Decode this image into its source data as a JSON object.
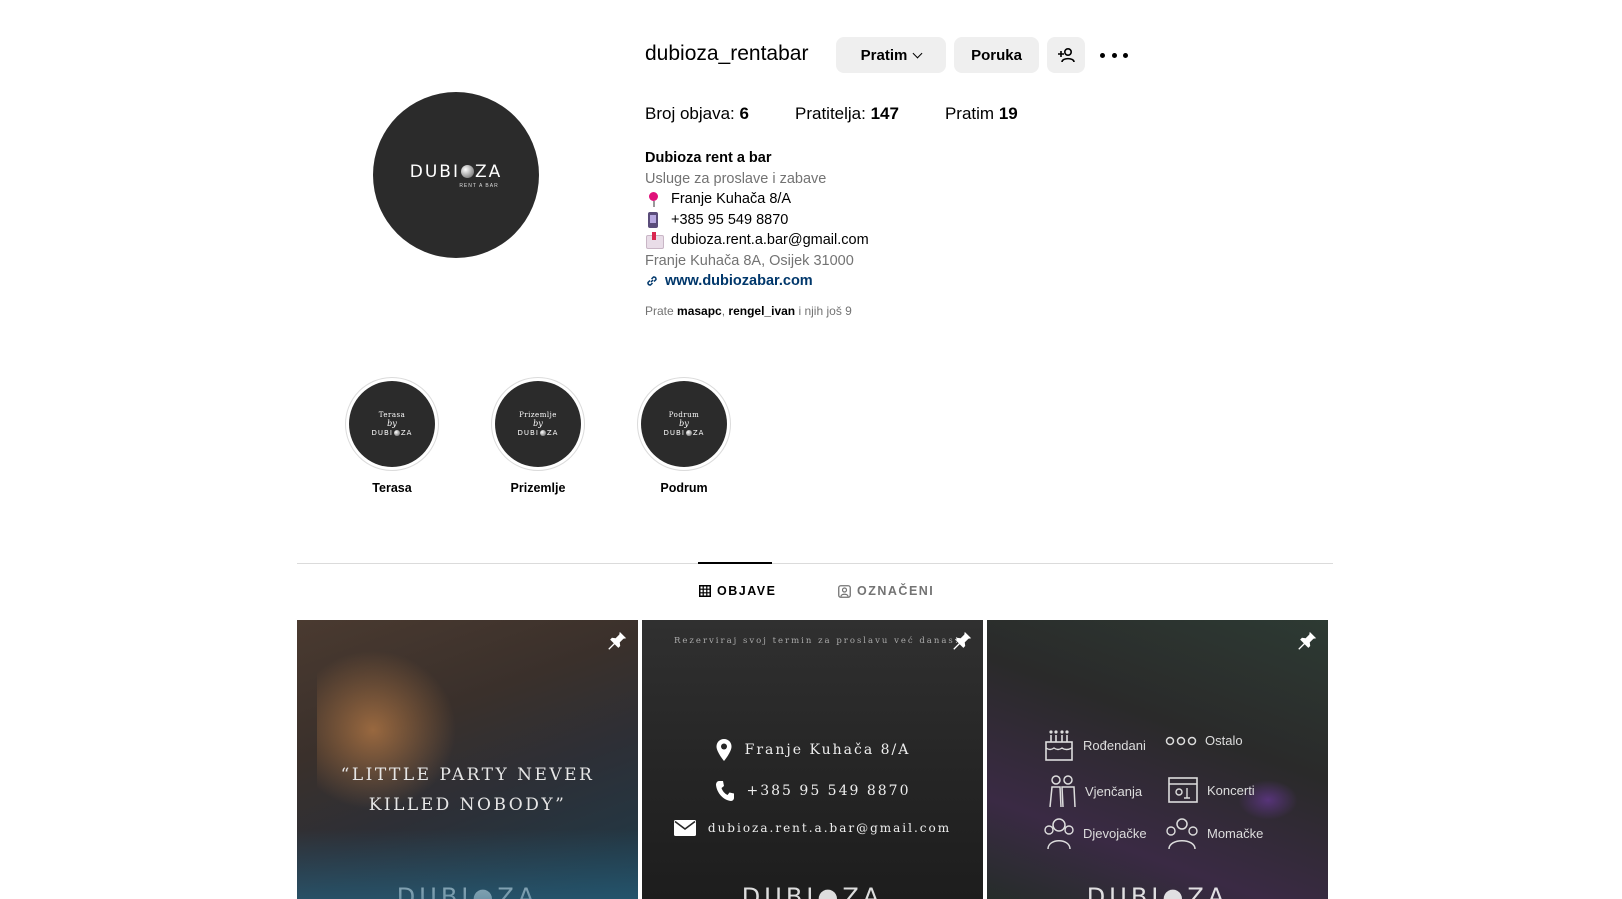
{
  "profile": {
    "username": "dubioza_rentabar",
    "avatar_brand": "DUBI",
    "avatar_brand_end": "ZA",
    "avatar_sub": "RENT A BAR"
  },
  "actions": {
    "follow_label": "Pratim",
    "message_label": "Poruka",
    "add_icon": "person-add-icon",
    "more_icon": "more-options-icon"
  },
  "stats": {
    "posts_label": "Broj objava:",
    "posts_value": "6",
    "followers_label": "Pratitelja:",
    "followers_value": "147",
    "following_label": "Pratim",
    "following_value": "19"
  },
  "bio": {
    "name": "Dubioza rent a bar",
    "category": "Usluge za proslave i zabave",
    "address_line": "Franje Kuhača 8/A",
    "phone_line": "+385 95 549 8870",
    "email_line": "dubioza.rent.a.bar@gmail.com",
    "location": "Franje Kuhača 8A, Osijek 31000",
    "website": "www.dubiozabar.com"
  },
  "followed_by": {
    "prefix": "Prate",
    "user1": "masapc",
    "sep": ",",
    "user2": "rengel_ivan",
    "suffix": "i njih još 9"
  },
  "highlights": [
    {
      "title_top": "Terasa",
      "by": "by",
      "label": "Terasa"
    },
    {
      "title_top": "Prizemlje",
      "by": "by",
      "label": "Prizemlje"
    },
    {
      "title_top": "Podrum",
      "by": "by",
      "label": "Podrum"
    }
  ],
  "highlight_brand": "DUBI",
  "highlight_brand_end": "ZA",
  "tabs": {
    "posts": "OBJAVE",
    "tagged": "OZNAČENI"
  },
  "posts": {
    "p1_quote_line1": "“LITTLE PARTY NEVER",
    "p1_quote_line2": "KILLED NOBODY”",
    "p2_top": "Rezerviraj svoj termin za proslavu već danas!",
    "p2_address": "Franje Kuhača 8/A",
    "p2_phone": "+385 95 549 8870",
    "p2_email": "dubioza.rent.a.bar@gmail.com",
    "p3_birthdays": "Rođendani",
    "p3_other": "Ostalo",
    "p3_weddings": "Vjenčanja",
    "p3_concerts": "Koncerti",
    "p3_bachelorette": "Djevojačke",
    "p3_bachelor": "Momačke",
    "brand": "DUBI",
    "brand_end": "ZA"
  },
  "colors": {
    "link": "#00376b",
    "muted": "#737373",
    "button_bg": "#efefef",
    "avatar_bg": "#2b2b2b"
  }
}
